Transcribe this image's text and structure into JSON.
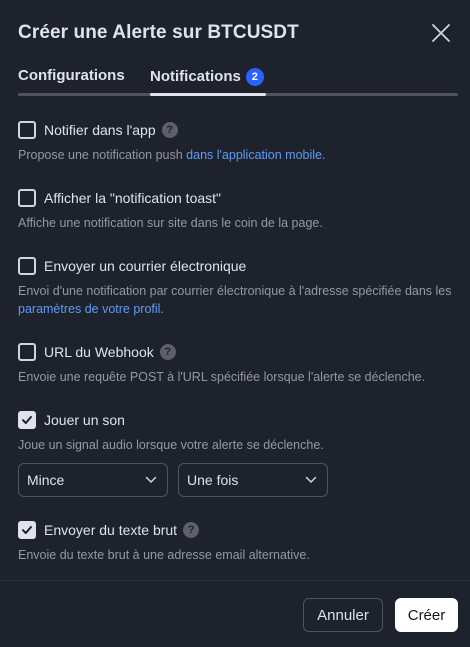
{
  "dialog": {
    "title": "Créer une Alerte sur BTCUSDT",
    "close_icon": "close-icon"
  },
  "tabs": [
    {
      "label": "Configurations",
      "active": false
    },
    {
      "label": "Notifications",
      "active": true,
      "badge": "2"
    }
  ],
  "options": [
    {
      "label": "Notifier dans l'app",
      "checked": false,
      "has_help": true,
      "help_glyph": "?",
      "desc_text": "Propose une notification push ",
      "desc_link": "dans l'application mobile",
      "desc_after": "."
    },
    {
      "label": "Afficher la \"notification toast\"",
      "checked": false,
      "has_help": false,
      "desc_text": "Affiche une notification sur site dans le coin de la page."
    },
    {
      "label": "Envoyer un courrier électronique",
      "checked": false,
      "has_help": false,
      "desc_text": "Envoi d'une notification par courrier électronique à l'adresse spécifiée dans les ",
      "desc_link": "paramètres de votre profil",
      "desc_after": "."
    },
    {
      "label": "URL du Webhook",
      "checked": false,
      "has_help": true,
      "help_glyph": "?",
      "desc_text": "Envoie une requête POST à l'URL spécifiée lorsque l'alerte se déclenche."
    },
    {
      "label": "Jouer un son",
      "checked": true,
      "has_help": false,
      "desc_text": "Joue un signal audio lorsque votre alerte se déclenche."
    },
    {
      "label": "Envoyer du texte brut",
      "checked": true,
      "has_help": true,
      "help_glyph": "?",
      "desc_text": "Envoie du texte brut à une adresse email alternative."
    }
  ],
  "sound": {
    "sound_value": "Mince",
    "frequency_value": "Une fois"
  },
  "footer": {
    "cancel_label": "Annuler",
    "create_label": "Créer"
  },
  "colors": {
    "background": "#1e222d",
    "accent": "#2962ff",
    "link": "#5b9cf6"
  }
}
